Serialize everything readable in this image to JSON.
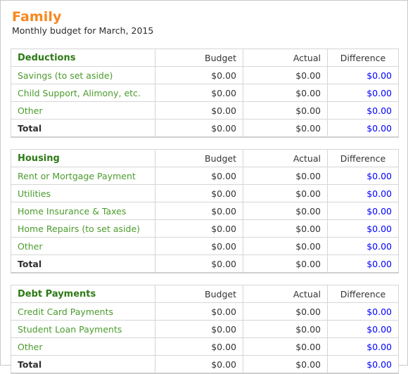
{
  "header": {
    "title": "Family",
    "subtitle": "Monthly budget for March, 2015"
  },
  "colors": {
    "title_orange": "#f6881f",
    "section_header_green": "#2d7a16",
    "row_label_green": "#4a9b2c",
    "difference_blue": "#0000ff",
    "amount_gray": "#333333",
    "border_gray": "#d6d6d6"
  },
  "columns": {
    "label": "",
    "budget": "Budget",
    "actual": "Actual",
    "difference": "Difference"
  },
  "sections": [
    {
      "name": "Deductions",
      "rows": [
        {
          "label": "Savings (to set aside)",
          "budget": "$0.00",
          "actual": "$0.00",
          "difference": "$0.00"
        },
        {
          "label": "Child Support, Alimony, etc.",
          "budget": "$0.00",
          "actual": "$0.00",
          "difference": "$0.00"
        },
        {
          "label": "Other",
          "budget": "$0.00",
          "actual": "$0.00",
          "difference": "$0.00"
        },
        {
          "label": "Total",
          "budget": "$0.00",
          "actual": "$0.00",
          "difference": "$0.00",
          "total": true
        }
      ]
    },
    {
      "name": "Housing",
      "rows": [
        {
          "label": "Rent or Mortgage Payment",
          "budget": "$0.00",
          "actual": "$0.00",
          "difference": "$0.00"
        },
        {
          "label": "Utilities",
          "budget": "$0.00",
          "actual": "$0.00",
          "difference": "$0.00"
        },
        {
          "label": "Home Insurance & Taxes",
          "budget": "$0.00",
          "actual": "$0.00",
          "difference": "$0.00"
        },
        {
          "label": "Home Repairs (to set aside)",
          "budget": "$0.00",
          "actual": "$0.00",
          "difference": "$0.00"
        },
        {
          "label": "Other",
          "budget": "$0.00",
          "actual": "$0.00",
          "difference": "$0.00"
        },
        {
          "label": "Total",
          "budget": "$0.00",
          "actual": "$0.00",
          "difference": "$0.00",
          "total": true
        }
      ]
    },
    {
      "name": "Debt Payments",
      "rows": [
        {
          "label": "Credit Card Payments",
          "budget": "$0.00",
          "actual": "$0.00",
          "difference": "$0.00"
        },
        {
          "label": "Student Loan Payments",
          "budget": "$0.00",
          "actual": "$0.00",
          "difference": "$0.00"
        },
        {
          "label": "Other",
          "budget": "$0.00",
          "actual": "$0.00",
          "difference": "$0.00"
        },
        {
          "label": "Total",
          "budget": "$0.00",
          "actual": "$0.00",
          "difference": "$0.00",
          "total": true
        }
      ]
    }
  ]
}
